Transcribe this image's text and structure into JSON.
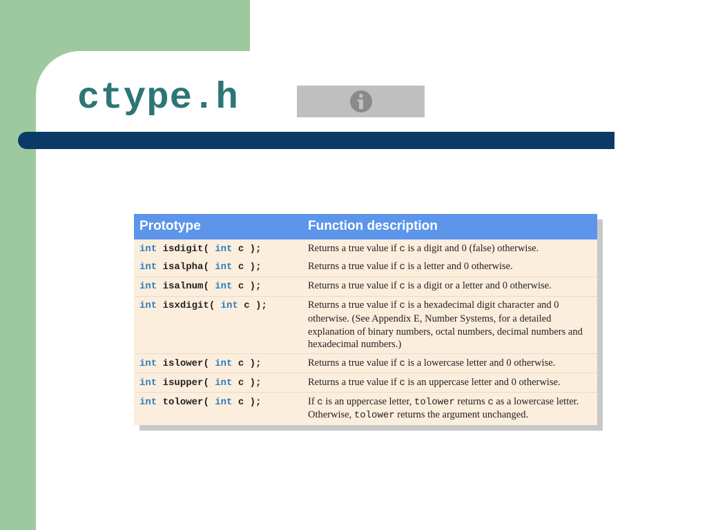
{
  "title": "ctype.h",
  "columns": {
    "proto": "Prototype",
    "desc": "Function description"
  },
  "kw": "int",
  "rows": [
    {
      "name": "isdigit",
      "arg": " c );",
      "d1": "Returns a true value if ",
      "c1": "c",
      "d2": " is a digit and 0 (false) otherwise.",
      "norule": true
    },
    {
      "name": "isalpha",
      "arg": " c );",
      "d1": "Returns a true value if ",
      "c1": "c",
      "d2": " is a letter and 0 otherwise."
    },
    {
      "name": "isalnum",
      "arg": " c );",
      "d1": "Returns a true value if ",
      "c1": "c",
      "d2": " is a digit or a letter and 0 otherwise."
    },
    {
      "name": "isxdigit",
      "arg": " c );",
      "d1": "Returns a true value if ",
      "c1": "c",
      "d2": " is a hexadecimal digit character and 0 otherwise. (See Appendix E, Number Systems, for a detailed explanation of binary numbers, octal numbers, decimal numbers and hexadecimal numbers.)"
    },
    {
      "name": "islower",
      "arg": " c );",
      "d1": "Returns a true value if ",
      "c1": "c",
      "d2": " is a lowercase letter and 0 otherwise."
    },
    {
      "name": "isupper",
      "arg": " c );",
      "d1": "Returns a true value if ",
      "c1": "c",
      "d2": " is an uppercase letter and 0 otherwise."
    },
    {
      "name": "tolower",
      "arg": " c );",
      "d1": "If ",
      "c1": "c",
      "d2": " is an uppercase letter, ",
      "c2": "tolower",
      "d3": " returns ",
      "c3": "c",
      "d4": " as a lowercase letter. Otherwise, ",
      "c4": "tolower",
      "d5": " returns the argument unchanged."
    }
  ]
}
